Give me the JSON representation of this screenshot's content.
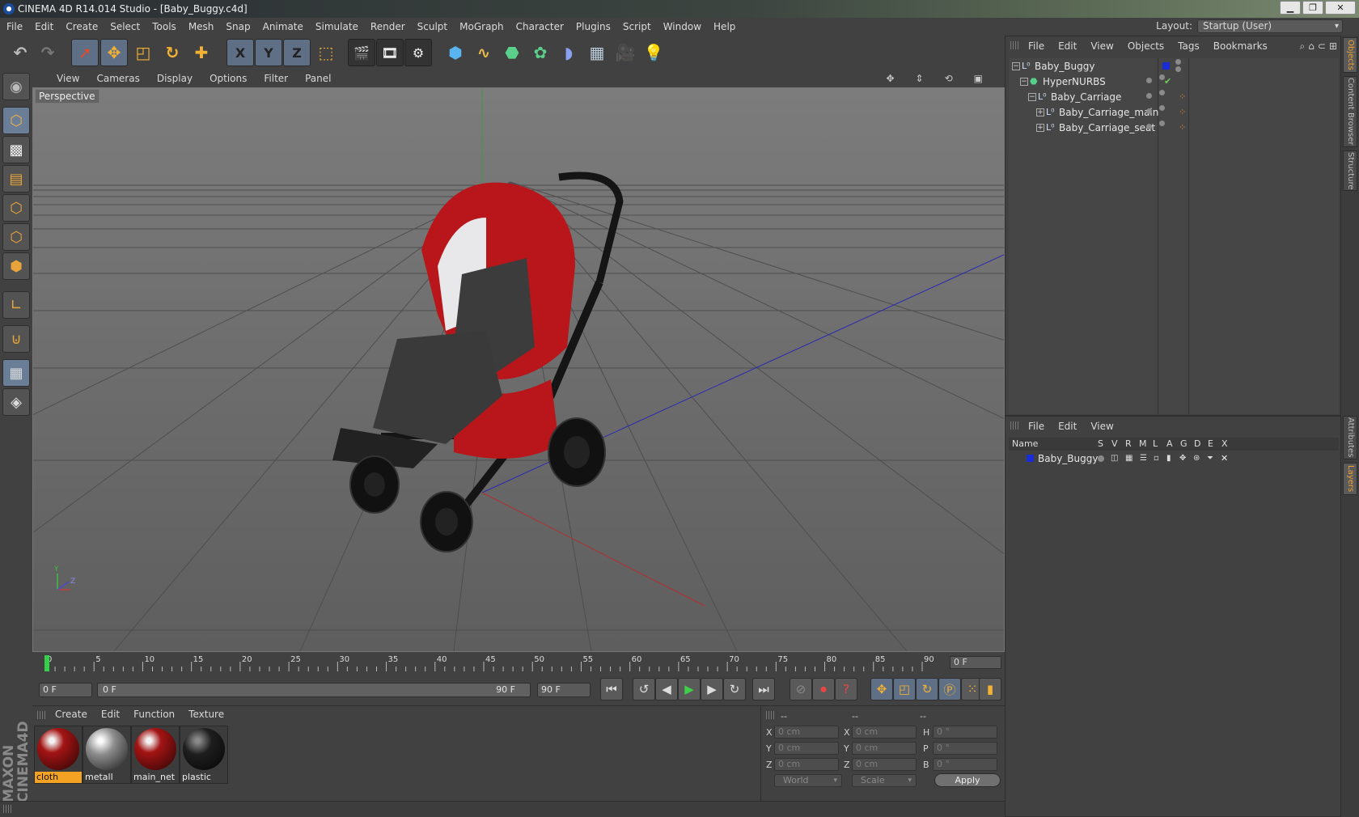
{
  "window": {
    "title": "CINEMA 4D R14.014 Studio - [Baby_Buggy.c4d]",
    "min": "▁",
    "max": "❐",
    "close": "✕"
  },
  "menu": [
    "File",
    "Edit",
    "Create",
    "Select",
    "Tools",
    "Mesh",
    "Snap",
    "Animate",
    "Simulate",
    "Render",
    "Sculpt",
    "MoGraph",
    "Character",
    "Plugins",
    "Script",
    "Window",
    "Help"
  ],
  "layout": {
    "label": "Layout:",
    "value": "Startup (User)"
  },
  "toolbar": {
    "undo": "undo-icon",
    "redo": "redo-icon",
    "live_select": "live-selection-icon",
    "move": "move-icon",
    "scale": "scale-icon",
    "rotate": "rotate-icon",
    "recent": "recent-tool-icon",
    "x_axis": "X",
    "y_axis": "Y",
    "z_axis": "Z",
    "coords": "world-coords-icon"
  },
  "viewport": {
    "menu": [
      "View",
      "Cameras",
      "Display",
      "Options",
      "Filter",
      "Panel"
    ],
    "label": "Perspective",
    "axis_y": "Y",
    "axis_z": "Z"
  },
  "timeline": {
    "ticks": [
      "0",
      "5",
      "10",
      "15",
      "20",
      "25",
      "30",
      "35",
      "40",
      "45",
      "50",
      "55",
      "60",
      "65",
      "70",
      "75",
      "80",
      "85",
      "90"
    ],
    "current_frame": "0 F"
  },
  "controls": {
    "start_field": "0 F",
    "range_start": "0 F",
    "range_end": "90 F",
    "end_field": "90 F"
  },
  "materials": {
    "menu": [
      "Create",
      "Edit",
      "Function",
      "Texture"
    ],
    "items": [
      {
        "name": "cloth",
        "selected": true,
        "color": "#a31414"
      },
      {
        "name": "metall",
        "selected": false,
        "color": "#8c8c8c"
      },
      {
        "name": "main_net",
        "selected": false,
        "color": "#a31414"
      },
      {
        "name": "plastic",
        "selected": false,
        "color": "#1e1e1e"
      }
    ]
  },
  "coordinates": {
    "header": [
      "--",
      "--",
      "--"
    ],
    "rows": [
      {
        "a": "X",
        "av": "0 cm",
        "b": "X",
        "bv": "0 cm",
        "c": "H",
        "cv": "0 °"
      },
      {
        "a": "Y",
        "av": "0 cm",
        "b": "Y",
        "bv": "0 cm",
        "c": "P",
        "cv": "0 °"
      },
      {
        "a": "Z",
        "av": "0 cm",
        "b": "Z",
        "bv": "0 cm",
        "c": "B",
        "cv": "0 °"
      }
    ],
    "mode": "World",
    "transform": "Scale",
    "apply": "Apply"
  },
  "objects": {
    "menu": [
      "File",
      "Edit",
      "View",
      "Objects",
      "Tags",
      "Bookmarks"
    ],
    "tree": [
      {
        "name": "Baby_Buggy",
        "depth": 0,
        "layer_color": "#1a2cd6"
      },
      {
        "name": "HyperNURBS",
        "depth": 1
      },
      {
        "name": "Baby_Carriage",
        "depth": 2
      },
      {
        "name": "Baby_Carriage_main",
        "depth": 3
      },
      {
        "name": "Baby_Carriage_seat",
        "depth": 3
      }
    ]
  },
  "layers": {
    "menu": [
      "File",
      "Edit",
      "View"
    ],
    "columns": [
      "Name",
      "S",
      "V",
      "R",
      "M",
      "L",
      "A",
      "G",
      "D",
      "E",
      "X"
    ],
    "rows": [
      {
        "name": "Baby_Buggy",
        "color": "#1a2cd6"
      }
    ]
  },
  "side_tabs": [
    "Objects",
    "Content Browser",
    "Structure",
    "Attributes",
    "Layers"
  ],
  "brand": "MAXON CINEMA4D"
}
